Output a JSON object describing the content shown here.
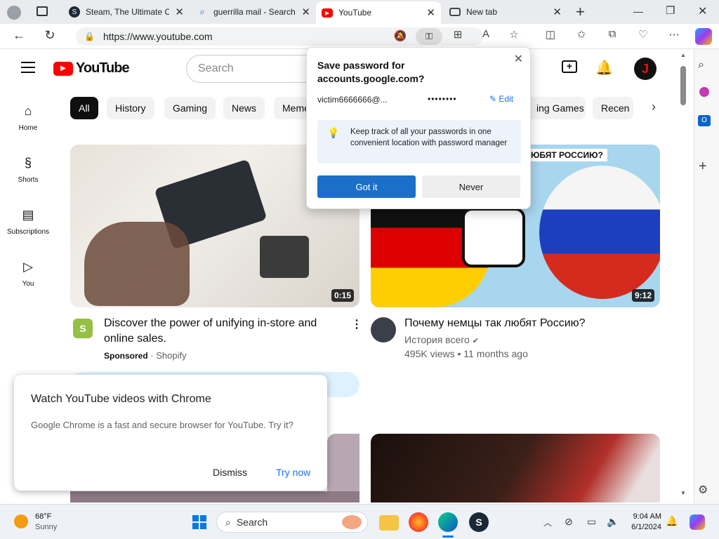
{
  "browser": {
    "tabs": [
      {
        "title": "Steam, The Ultimate O",
        "close": "✕"
      },
      {
        "title": "guerrilla mail - Search",
        "close": "✕"
      },
      {
        "title": "YouTube",
        "close": "✕"
      },
      {
        "title": "New tab",
        "close": "✕"
      }
    ],
    "new_tab": "+",
    "url": "https://www.youtube.com",
    "window_controls": {
      "minimize": "—",
      "restore": "❐",
      "close": "✕"
    }
  },
  "youtube": {
    "logo_text": "YouTube",
    "search_placeholder": "Search",
    "chips": [
      "All",
      "History",
      "Gaming",
      "News",
      "Memes",
      "ing Games",
      "Recen"
    ],
    "guide": [
      {
        "label": "Home",
        "icon": "home-icon"
      },
      {
        "label": "Shorts",
        "icon": "shorts-icon"
      },
      {
        "label": "Subscriptions",
        "icon": "subscriptions-icon"
      },
      {
        "label": "You",
        "icon": "you-icon"
      }
    ],
    "videos": [
      {
        "title": "Discover the power of unifying in-store and online sales.",
        "sponsored": "Sponsored",
        "channel": "Shopify",
        "duration": "0:15"
      },
      {
        "title": "Почему немцы так любят Россию?",
        "channel": "История всего",
        "stats": "495K views • 11 months ago",
        "duration": "9:12",
        "thumb_text": "ЮБЯТ РОССИЮ?"
      }
    ]
  },
  "password_prompt": {
    "title": "Save password for accounts.google.com?",
    "username": "victim6666666@...",
    "password_mask": "••••••••",
    "edit": "Edit",
    "tip": "Keep track of all your passwords in one convenient location with password manager",
    "got_it": "Got it",
    "never": "Never"
  },
  "chrome_promo": {
    "title": "Watch YouTube videos with Chrome",
    "body": "Google Chrome is a fast and secure browser for YouTube. Try it?",
    "dismiss": "Dismiss",
    "try_now": "Try now"
  },
  "taskbar": {
    "weather_temp": "68°F",
    "weather_desc": "Sunny",
    "search": "Search",
    "time": "9:04 AM",
    "date": "6/1/2024"
  }
}
